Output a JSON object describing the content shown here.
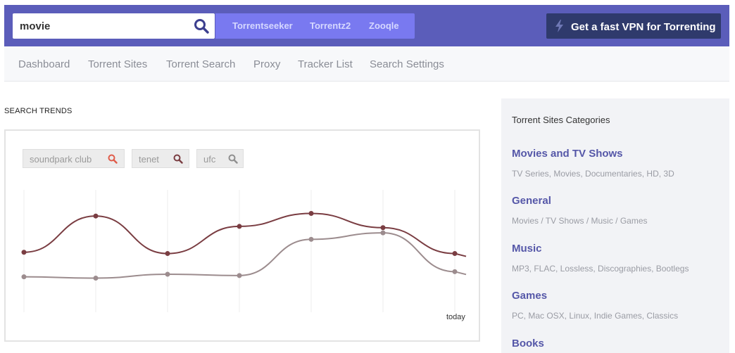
{
  "header": {
    "search": {
      "value": "movie",
      "icon": "search-icon"
    },
    "engines": [
      "Torrentseeker",
      "Torrentz2",
      "Zooqle"
    ],
    "vpn_button": {
      "label": "Get a fast VPN for Torrenting",
      "icon": "bolt-icon"
    },
    "colors": {
      "header_bg": "#5b5dba",
      "engines_bg": "#7979f0",
      "vpn_bg": "#2f3a6c"
    }
  },
  "nav": {
    "items": [
      "Dashboard",
      "Torrent Sites",
      "Torrent Search",
      "Proxy",
      "Tracker List",
      "Search Settings"
    ]
  },
  "trends": {
    "title": "SEARCH TRENDS",
    "tags": [
      {
        "label": "soundpark club",
        "icon": "search-icon",
        "icon_color": "#e05c4a"
      },
      {
        "label": "tenet",
        "icon": "search-icon",
        "icon_color": "#7a3d42"
      },
      {
        "label": "ufc",
        "icon": "search-icon",
        "icon_color": "#8f8f8f"
      }
    ],
    "today_label": "today"
  },
  "chart_data": {
    "type": "line",
    "x": [
      1,
      2,
      3,
      4,
      5,
      6,
      7
    ],
    "series": [
      {
        "color": "#7a3d42",
        "values": [
          42,
          70,
          41,
          62,
          72,
          61,
          41
        ]
      },
      {
        "color": "#9c8c8e",
        "values": [
          23,
          22,
          25,
          24,
          52,
          57,
          27
        ]
      }
    ],
    "ylim": [
      0,
      100
    ],
    "grid": true
  },
  "sidebar": {
    "title": "Torrent Sites Categories",
    "categories": [
      {
        "title": "Movies and TV Shows",
        "desc": "TV Series, Movies, Documentaries, HD, 3D"
      },
      {
        "title": "General",
        "desc": "Movies / TV Shows / Music / Games"
      },
      {
        "title": "Music",
        "desc": "MP3, FLAC, Lossless, Discographies, Bootlegs"
      },
      {
        "title": "Games",
        "desc": "PC, Mac OSX, Linux, Indie Games, Classics"
      },
      {
        "title": "Books",
        "desc": ""
      }
    ]
  }
}
